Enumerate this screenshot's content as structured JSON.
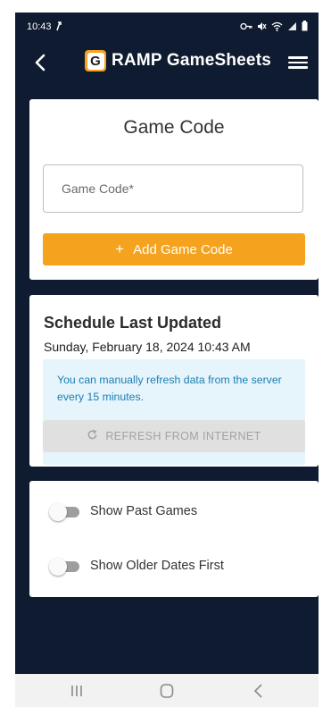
{
  "status_bar": {
    "time": "10:43",
    "icons": [
      "location-arrow-icon",
      "vpn-key-icon",
      "mute-icon",
      "wifi-icon",
      "signal-icon",
      "battery-icon"
    ]
  },
  "app_bar": {
    "brand_letter": "G",
    "title": "RAMP GameSheets",
    "back_icon": "back-arrow-icon",
    "menu_icon": "hamburger-menu-icon"
  },
  "game_code_card": {
    "title": "Game Code",
    "input_placeholder": "Game Code*",
    "input_value": "",
    "add_button_icon": "+",
    "add_button_label": "Add Game Code"
  },
  "schedule_card": {
    "title": "Schedule Last Updated",
    "date": "Sunday, February 18, 2024 10:43 AM",
    "info_text": "You can manually refresh data from the server every 15 minutes.",
    "refresh_label": "REFRESH FROM INTERNET"
  },
  "options_card": {
    "show_past_games": {
      "label": "Show Past Games",
      "on": false
    },
    "show_older_dates_first": {
      "label": "Show Older Dates First",
      "on": false
    }
  },
  "nav_bar": {
    "items": [
      "recents-icon",
      "home-icon",
      "back-icon"
    ]
  },
  "colors": {
    "background": "#0f1b30",
    "accent": "#f5a31e",
    "info_bg": "#e6f4fb",
    "info_text": "#1b7fb2"
  }
}
